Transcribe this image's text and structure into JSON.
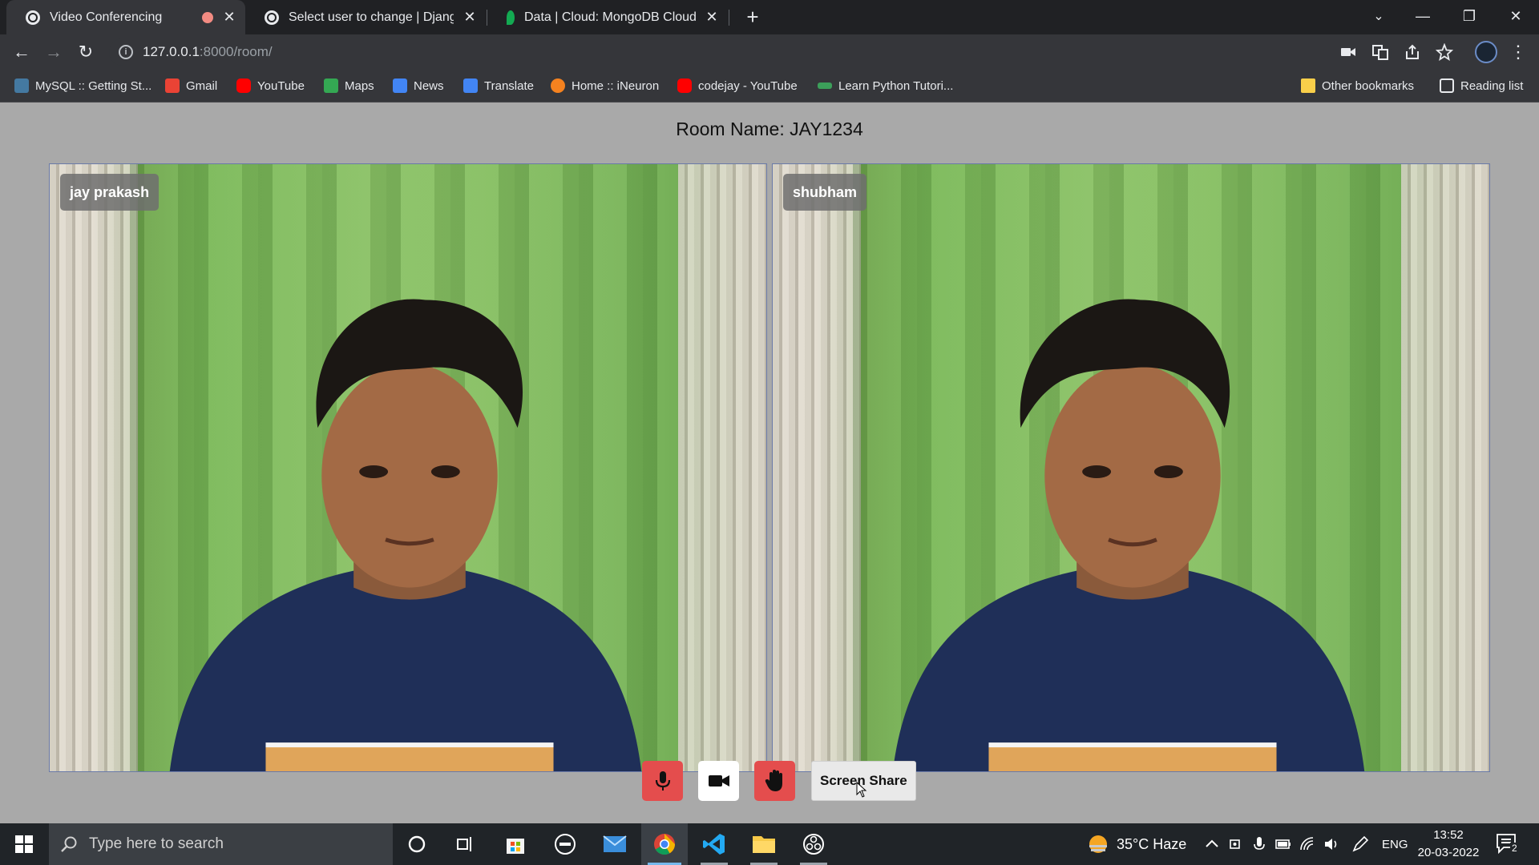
{
  "browser": {
    "tabs": [
      {
        "title": "Video Conferencing",
        "recording": true
      },
      {
        "title": "Select user to change | Django si",
        "recording": false
      },
      {
        "title": "Data | Cloud: MongoDB Cloud",
        "recording": false
      }
    ],
    "url": {
      "host": "127.0.0.1",
      "path": ":8000/room/"
    },
    "bookmarks": [
      {
        "label": "MySQL :: Getting St...",
        "icon": "mysql-icon",
        "color": "#4479a1"
      },
      {
        "label": "Gmail",
        "icon": "gmail-icon",
        "color": "#ea4335"
      },
      {
        "label": "YouTube",
        "icon": "youtube-icon",
        "color": "#ff0000"
      },
      {
        "label": "Maps",
        "icon": "maps-icon",
        "color": "#34a853"
      },
      {
        "label": "News",
        "icon": "news-icon",
        "color": "#4285f4"
      },
      {
        "label": "Translate",
        "icon": "translate-icon",
        "color": "#4285f4"
      },
      {
        "label": "Home :: iNeuron",
        "icon": "ineuron-icon",
        "color": "#f5821f"
      },
      {
        "label": "codejay - YouTube",
        "icon": "youtube-icon",
        "color": "#ff0000"
      },
      {
        "label": "Learn Python Tutori...",
        "icon": "python-icon",
        "color": "#3c9f5a"
      }
    ],
    "other_bookmarks": "Other bookmarks",
    "reading_list": "Reading list"
  },
  "room": {
    "title": "Room Name: JAY1234",
    "participants": [
      {
        "name": "jay prakash"
      },
      {
        "name": "shubham"
      }
    ],
    "controls": {
      "mic": "microphone-icon",
      "camera": "video-camera-icon",
      "raise_hand": "hand-icon",
      "screen_share_label": "Screen Share"
    }
  },
  "taskbar": {
    "search_placeholder": "Type here to search",
    "weather": "35°C  Haze",
    "language": "ENG",
    "time": "13:52",
    "date": "20-03-2022",
    "notification_count": "2"
  },
  "colors": {
    "control_red": "#e44d4d",
    "page_bg": "#a9a9a9",
    "chrome_dark": "#202124"
  }
}
